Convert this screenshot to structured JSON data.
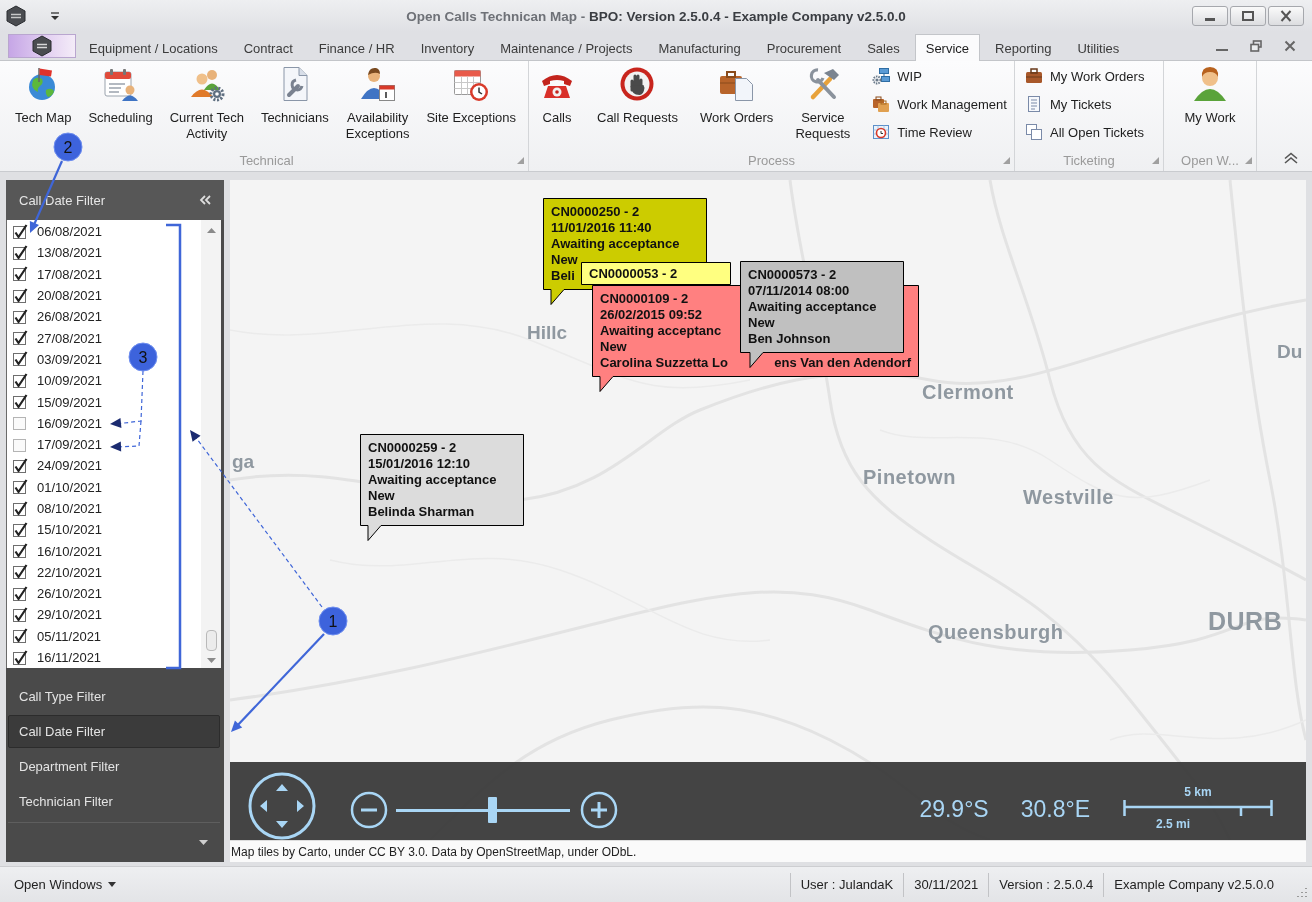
{
  "window": {
    "title": "Open Calls Technican Map - **BPO: Version 2.5.0.4 - Example Company v2.5.0.0**"
  },
  "ribbon": {
    "tabs": [
      {
        "label": "Equipment / Locations",
        "selected": false
      },
      {
        "label": "Contract",
        "selected": false
      },
      {
        "label": "Finance / HR",
        "selected": false
      },
      {
        "label": "Inventory",
        "selected": false
      },
      {
        "label": "Maintenance / Projects",
        "selected": false
      },
      {
        "label": "Manufacturing",
        "selected": false
      },
      {
        "label": "Procurement",
        "selected": false
      },
      {
        "label": "Sales",
        "selected": false
      },
      {
        "label": "Service",
        "selected": true
      },
      {
        "label": "Reporting",
        "selected": false
      },
      {
        "label": "Utilities",
        "selected": false
      }
    ],
    "groups": [
      {
        "label": "Technical",
        "items": [
          {
            "kind": "large",
            "label": "Tech Map"
          },
          {
            "kind": "large",
            "label": "Scheduling"
          },
          {
            "kind": "large",
            "label": "Current Tech\nActivity"
          },
          {
            "kind": "large",
            "label": "Technicians"
          },
          {
            "kind": "large",
            "label": "Availability\nExceptions"
          },
          {
            "kind": "large",
            "label": "Site Exceptions"
          }
        ]
      },
      {
        "label": "Process",
        "items": [
          {
            "kind": "large",
            "label": "Calls"
          },
          {
            "kind": "large",
            "label": "Call Requests"
          },
          {
            "kind": "large",
            "label": "Work Orders"
          },
          {
            "kind": "large",
            "label": "Service\nRequests"
          },
          {
            "kind": "small",
            "label": "WIP"
          },
          {
            "kind": "small",
            "label": "Work Management"
          },
          {
            "kind": "small",
            "label": "Time Review"
          }
        ]
      },
      {
        "label": "Ticketing",
        "items": [
          {
            "kind": "small",
            "label": "My Work Orders"
          },
          {
            "kind": "small",
            "label": "My Tickets"
          },
          {
            "kind": "small",
            "label": "All Open Tickets"
          }
        ]
      },
      {
        "label": "Open W...",
        "items": [
          {
            "kind": "large",
            "label": "My Work"
          }
        ]
      }
    ]
  },
  "filter_panel": {
    "title": "Call Date Filter",
    "dates": [
      {
        "label": "06/08/2021",
        "checked": true
      },
      {
        "label": "13/08/2021",
        "checked": true
      },
      {
        "label": "17/08/2021",
        "checked": true
      },
      {
        "label": "20/08/2021",
        "checked": true
      },
      {
        "label": "26/08/2021",
        "checked": true
      },
      {
        "label": "27/08/2021",
        "checked": true
      },
      {
        "label": "03/09/2021",
        "checked": true
      },
      {
        "label": "10/09/2021",
        "checked": true
      },
      {
        "label": "15/09/2021",
        "checked": true
      },
      {
        "label": "16/09/2021",
        "checked": false
      },
      {
        "label": "17/09/2021",
        "checked": false
      },
      {
        "label": "24/09/2021",
        "checked": true
      },
      {
        "label": "01/10/2021",
        "checked": true
      },
      {
        "label": "08/10/2021",
        "checked": true
      },
      {
        "label": "15/10/2021",
        "checked": true
      },
      {
        "label": "16/10/2021",
        "checked": true
      },
      {
        "label": "22/10/2021",
        "checked": true
      },
      {
        "label": "26/10/2021",
        "checked": true
      },
      {
        "label": "29/10/2021",
        "checked": true
      },
      {
        "label": "05/11/2021",
        "checked": true
      },
      {
        "label": "16/11/2021",
        "checked": true
      }
    ],
    "sections": [
      {
        "label": "Call Type Filter",
        "selected": false
      },
      {
        "label": "Call Date Filter",
        "selected": true
      },
      {
        "label": "Department Filter",
        "selected": false
      },
      {
        "label": "Technician Filter",
        "selected": false
      }
    ]
  },
  "map": {
    "place_labels": [
      "Hillc",
      "Du",
      "Clermont",
      "ga",
      "Pinetown",
      "Westville",
      "Queensburgh",
      "DURB"
    ],
    "callouts": [
      {
        "color": "#cccc00",
        "lines": [
          [
            "CN0000250 - 2"
          ],
          [
            "11/01/2016 11:40"
          ],
          [
            "Awaiting acceptance"
          ],
          [
            "New"
          ],
          [
            "Beli"
          ]
        ]
      },
      {
        "color": "#ffff80",
        "lines": [
          [
            "CN0000053 - 2"
          ]
        ]
      },
      {
        "color": "#ff8080",
        "lines": [
          [
            "CN0000109 - 2"
          ],
          [
            "26/02/2015 09:52"
          ],
          [
            "Awaiting acceptanc"
          ],
          [
            "New"
          ],
          [
            "Carolina Suzzetta Lo",
            "ens Van den Adendorf"
          ]
        ]
      },
      {
        "color": "#c0c0c0",
        "lines": [
          [
            "CN0000573 - 2"
          ],
          [
            "07/11/2014 08:00"
          ],
          [
            "Awaiting acceptance"
          ],
          [
            "New"
          ],
          [
            "Ben Johnson"
          ]
        ]
      },
      {
        "color": "#dcdcdc",
        "lines": [
          [
            "CN0000259 - 2"
          ],
          [
            "15/01/2016 12:10"
          ],
          [
            "Awaiting acceptance"
          ],
          [
            "New"
          ],
          [
            "Belinda Sharman"
          ]
        ]
      }
    ],
    "zoom_slider": {
      "level": 0.55
    },
    "latitude": "29.9°S",
    "longitude": "30.8°E",
    "scale": {
      "top": "5 km",
      "bottom": "2.5 mi"
    },
    "attribution": "Map tiles by Carto, under CC BY 3.0. Data by OpenStreetMap, under ODbL."
  },
  "status_bar": {
    "open_windows": "Open Windows",
    "user": "User : JulandaK",
    "date": "30/11/2021",
    "version": "Version : 2.5.0.4",
    "company": "Example Company v2.5.0.0"
  },
  "annotations": [
    {
      "number": "2"
    },
    {
      "number": "3"
    },
    {
      "number": "1"
    }
  ]
}
